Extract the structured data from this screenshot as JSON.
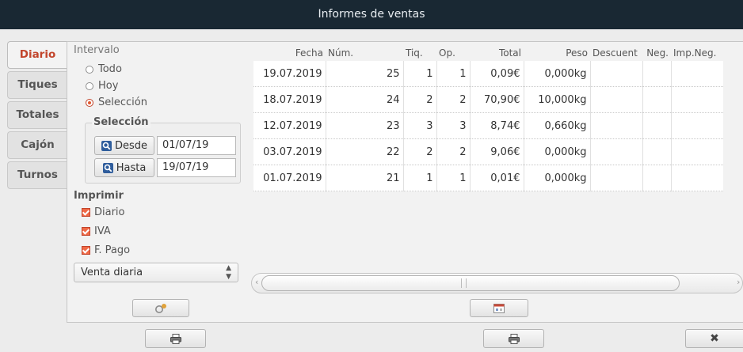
{
  "window": {
    "title": "Informes de ventas"
  },
  "tabs": [
    {
      "label": "Diario",
      "active": true
    },
    {
      "label": "Tiques",
      "active": false
    },
    {
      "label": "Totales",
      "active": false
    },
    {
      "label": "Cajón",
      "active": false
    },
    {
      "label": "Turnos",
      "active": false
    }
  ],
  "intervalo": {
    "label": "Intervalo",
    "options": [
      "Todo",
      "Hoy",
      "Selección"
    ],
    "selected": "Selección"
  },
  "seleccion": {
    "label": "Selección",
    "desde_label": "Desde",
    "desde_value": "01/07/19",
    "hasta_label": "Hasta",
    "hasta_value": "19/07/19"
  },
  "imprimir": {
    "label": "Imprimir",
    "checks": [
      {
        "label": "Diario",
        "checked": true
      },
      {
        "label": "IVA",
        "checked": true
      },
      {
        "label": "F. Pago",
        "checked": true
      }
    ],
    "report_select": "Venta diaria"
  },
  "table": {
    "columns": [
      "Fecha",
      "Núm.",
      "Tiq.",
      "Op.",
      "Total",
      "Peso",
      "Descuent",
      "Neg.",
      "Imp.Neg."
    ],
    "rows": [
      [
        "19.07.2019",
        "25",
        "1",
        "1",
        "0,09€",
        "0,000kg",
        "",
        "",
        ""
      ],
      [
        "18.07.2019",
        "24",
        "2",
        "2",
        "70,90€",
        "10,000kg",
        "",
        "",
        ""
      ],
      [
        "12.07.2019",
        "23",
        "3",
        "3",
        "8,74€",
        "0,660kg",
        "",
        "",
        ""
      ],
      [
        "03.07.2019",
        "22",
        "2",
        "2",
        "9,06€",
        "0,000kg",
        "",
        "",
        ""
      ],
      [
        "01.07.2019",
        "21",
        "1",
        "1",
        "0,01€",
        "0,000kg",
        "",
        "",
        ""
      ]
    ]
  },
  "icons": {
    "search": "search-icon",
    "refresh": "refresh-icon",
    "calendar": "calendar-icon",
    "print": "printer-icon",
    "close": "close-icon"
  },
  "colors": {
    "accent": "#c2452c",
    "titlebar": "#192833"
  }
}
